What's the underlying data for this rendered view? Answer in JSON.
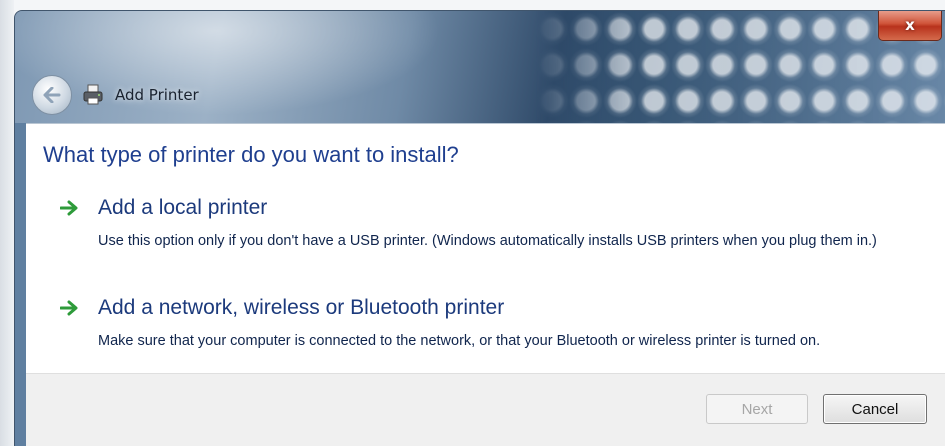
{
  "window": {
    "title": "Add Printer",
    "close_label": "x"
  },
  "main": {
    "heading": "What type of printer do you want to install?",
    "options": [
      {
        "title": "Add a local printer",
        "description": "Use this option only if you don't have a USB printer. (Windows automatically installs USB printers when you plug them in.)"
      },
      {
        "title": "Add a network, wireless or Bluetooth printer",
        "description": "Make sure that your computer is connected to the network, or that your Bluetooth or wireless printer is turned on."
      }
    ]
  },
  "footer": {
    "next_label": "Next",
    "cancel_label": "Cancel"
  },
  "icons": {
    "back": "back-arrow-icon",
    "printer": "printer-icon",
    "option_arrow": "green-arrow-icon",
    "close": "close-icon"
  },
  "colors": {
    "heading": "#1f3f8f",
    "option_arrow": "#2e9b3a",
    "close_button": "#c8442a"
  }
}
